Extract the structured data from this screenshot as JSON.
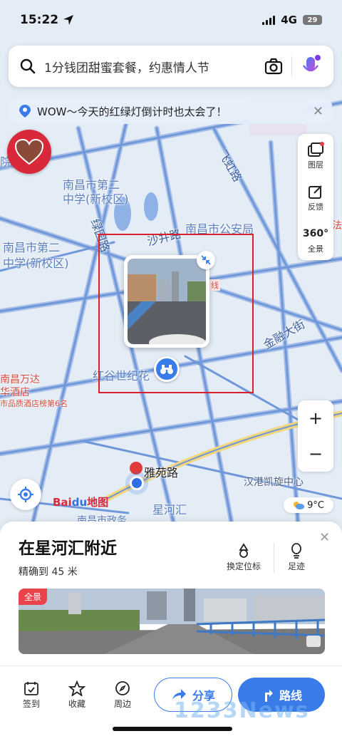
{
  "status_bar": {
    "time": "15:22",
    "network": "4G",
    "battery": "29"
  },
  "search": {
    "placeholder": "1分钱团甜蜜套餐，约惠情人节"
  },
  "notice": {
    "text": "WOW～今天的红绿灯倒计时也太会了！"
  },
  "tools": [
    {
      "label": "图层",
      "icon": "layers-icon"
    },
    {
      "label": "反馈",
      "icon": "feedback-icon"
    },
    {
      "label": "全景",
      "icon": "panorama-360-icon",
      "badge": "360°"
    }
  ],
  "zoom": {
    "in": "+",
    "out": "−"
  },
  "map_labels": {
    "school1": "南昌市第二",
    "school1b": "中学(新校区)",
    "school2": "南昌市第二",
    "school2b": "中学(新校区)",
    "yuan": "院",
    "lvyuan": "绿园路",
    "shajing": "沙井路",
    "police": "南昌市公安局",
    "hongxiang": "红谷世纪花",
    "jinsheng": "金融大街",
    "feihong": "飞虹路",
    "wanda1": "南昌万达",
    "wanda2": "华酒店",
    "wanda3": "市品质酒店榜第6名",
    "yayuan": "雅苑路",
    "hangang": "汉港凯旋中心",
    "xingheng": "星河汇",
    "nanchang_bottom": "南昌市政务",
    "xian": "线",
    "fa": "法"
  },
  "baidu_logo": {
    "a": "Bai",
    "b": "du",
    "c": "地图"
  },
  "weather": {
    "temp": "9°C"
  },
  "sheet": {
    "title": "在星河汇附近",
    "subtitle": "精确到 45 米",
    "actions": [
      {
        "label": "换定位标"
      },
      {
        "label": "足迹"
      }
    ],
    "pano_badge": "全景"
  },
  "bottom_nav": [
    {
      "label": "签到",
      "icon": "checkin-icon"
    },
    {
      "label": "收藏",
      "icon": "star-icon"
    },
    {
      "label": "周边",
      "icon": "compass-icon"
    }
  ],
  "share_label": "分享",
  "route_label": "路线",
  "watermark": "1233News",
  "colors": {
    "accent": "#3a7bea",
    "highlight_box": "#d81f2a",
    "road": "#6f97d9"
  }
}
